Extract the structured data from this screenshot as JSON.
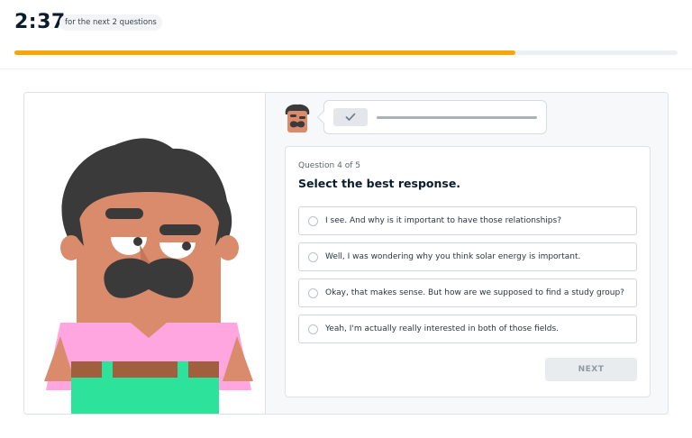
{
  "timer": {
    "value": "2:37",
    "note": "for the next 2 questions"
  },
  "progress": {
    "fraction": 0.755
  },
  "speech": {
    "play_icon": "check-icon"
  },
  "question": {
    "counter": "Question 4 of 5",
    "prompt": "Select the best response.",
    "options": [
      "I see. And why is it important to have those relationships?",
      "Well, I was wondering why you think solar energy is important.",
      "Okay, that makes sense. But how are we supposed to find a study group?",
      "Yeah, I'm actually really interested in both of those fields."
    ],
    "next_label": "NEXT"
  },
  "colors": {
    "accent": "#f7a800",
    "skin": "#d98b6c",
    "hair": "#3a3a3a",
    "shirt": "#ffa6e0",
    "belt": "#a0603e",
    "pants": "#2de29a"
  }
}
